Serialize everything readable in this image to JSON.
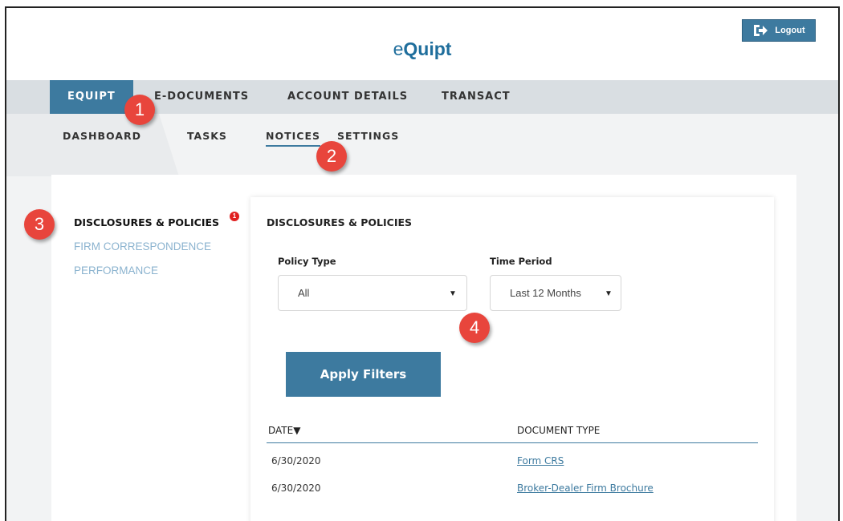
{
  "header": {
    "logo_prefix": "e",
    "logo_main": "Quipt",
    "logout_label": "Logout"
  },
  "topnav": {
    "tabs": [
      {
        "label": "EQUIPT",
        "active": true
      },
      {
        "label": "E-DOCUMENTS",
        "active": false
      },
      {
        "label": "ACCOUNT DETAILS",
        "active": false
      },
      {
        "label": "TRANSACT",
        "active": false
      }
    ]
  },
  "subnav": {
    "tabs": [
      {
        "label": "DASHBOARD",
        "active": false
      },
      {
        "label": "TASKS",
        "active": false
      },
      {
        "label": "NOTICES",
        "active": true
      },
      {
        "label": "SETTINGS",
        "active": false
      }
    ]
  },
  "sidebar": {
    "items": [
      {
        "label": "DISCLOSURES & POLICIES",
        "active": true,
        "badge": "1"
      },
      {
        "label": "FIRM CORRESPONDENCE",
        "active": false
      },
      {
        "label": "PERFORMANCE",
        "active": false
      }
    ]
  },
  "card": {
    "title": "DISCLOSURES & POLICIES",
    "policy_type_label": "Policy Type",
    "policy_type_value": "All",
    "time_period_label": "Time Period",
    "time_period_value": "Last 12 Months",
    "apply_label": "Apply Filters",
    "table": {
      "headers": [
        "DATE▼",
        "DOCUMENT TYPE"
      ],
      "rows": [
        {
          "date": "6/30/2020",
          "doc": "Form CRS"
        },
        {
          "date": "6/30/2020",
          "doc": "Broker-Dealer Firm Brochure"
        }
      ]
    }
  },
  "callouts": [
    "1",
    "2",
    "3",
    "4"
  ],
  "colors": {
    "accent": "#3d7a9f",
    "callout": "#e8453c",
    "nav_bg": "#d9dee2"
  }
}
